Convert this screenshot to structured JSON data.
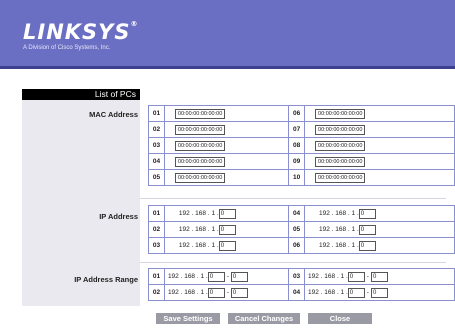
{
  "header": {
    "brand": "LINKSYS",
    "reg": "®",
    "tagline": "A Division of Cisco Systems, Inc."
  },
  "section": {
    "tab_label": "List of PCs"
  },
  "labels": {
    "mac": "MAC Address",
    "ip": "IP Address",
    "range": "IP Address Range"
  },
  "mac_rows": [
    {
      "l_num": "01",
      "l_val": "00:00:00:00:00:00",
      "r_num": "06",
      "r_val": "00:00:00:00:00:00"
    },
    {
      "l_num": "02",
      "l_val": "00:00:00:00:00:00",
      "r_num": "07",
      "r_val": "00:00:00:00:00:00"
    },
    {
      "l_num": "03",
      "l_val": "00:00:00:00:00:00",
      "r_num": "08",
      "r_val": "00:00:00:00:00:00"
    },
    {
      "l_num": "04",
      "l_val": "00:00:00:00:00:00",
      "r_num": "09",
      "r_val": "00:00:00:00:00:00"
    },
    {
      "l_num": "05",
      "l_val": "00:00:00:00:00:00",
      "r_num": "10",
      "r_val": "00:00:00:00:00:00"
    }
  ],
  "ip_prefix": "192 . 168 . 1 .",
  "ip_rows": [
    {
      "l_num": "01",
      "l_val": "0",
      "r_num": "04",
      "r_val": "0"
    },
    {
      "l_num": "02",
      "l_val": "0",
      "r_num": "05",
      "r_val": "0"
    },
    {
      "l_num": "03",
      "l_val": "0",
      "r_num": "06",
      "r_val": "0"
    }
  ],
  "range_rows": [
    {
      "l_num": "01",
      "l_from": "0",
      "l_to": "0",
      "r_num": "03",
      "r_from": "0",
      "r_to": "0"
    },
    {
      "l_num": "02",
      "l_from": "0",
      "l_to": "0",
      "r_num": "04",
      "r_from": "0",
      "r_to": "0"
    }
  ],
  "buttons": {
    "save": "Save Settings",
    "cancel": "Cancel Changes",
    "close": "Close"
  }
}
